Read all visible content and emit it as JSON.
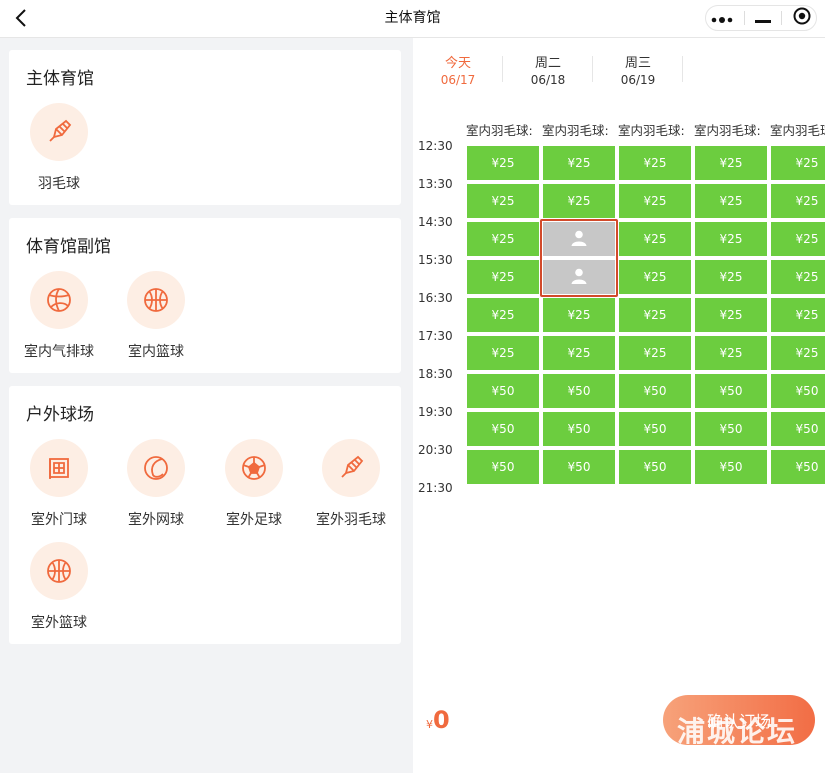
{
  "topbar": {
    "title": "主体育馆",
    "back_icon": "chevron-left-icon",
    "menu_icons": [
      "more-dots-icon",
      "minimize-icon",
      "target-close-icon"
    ]
  },
  "colors": {
    "accent": "#f06a3e",
    "available": "#6ccd3f",
    "booked": "#c7c7c7",
    "selection": "#d24a2a",
    "icon_bg": "#fdeee4"
  },
  "venues": [
    {
      "title": "主体育馆",
      "sports": [
        {
          "label": "羽毛球",
          "icon": "badminton-icon"
        }
      ]
    },
    {
      "title": "体育馆副馆",
      "sports": [
        {
          "label": "室内气排球",
          "icon": "volleyball-icon"
        },
        {
          "label": "室内篮球",
          "icon": "basketball-icon"
        }
      ]
    },
    {
      "title": "户外球场",
      "sports": [
        {
          "label": "室外门球",
          "icon": "gateball-icon"
        },
        {
          "label": "室外网球",
          "icon": "tennis-icon"
        },
        {
          "label": "室外足球",
          "icon": "football-icon"
        },
        {
          "label": "室外羽毛球",
          "icon": "badminton-icon"
        },
        {
          "label": "室外篮球",
          "icon": "basketball-icon"
        }
      ]
    }
  ],
  "days": [
    {
      "week": "今天",
      "date": "06/17",
      "active": true
    },
    {
      "week": "周二",
      "date": "06/18",
      "active": false
    },
    {
      "week": "周三",
      "date": "06/19",
      "active": false
    }
  ],
  "court_headers": [
    "室内羽毛球:",
    "室内羽毛球:",
    "室内羽毛球:",
    "室内羽毛球:",
    "室内羽毛球"
  ],
  "times": [
    "12:30",
    "13:30",
    "14:30",
    "15:30",
    "16:30",
    "17:30",
    "18:30",
    "19:30",
    "20:30",
    "21:30"
  ],
  "rows": [
    [
      "¥25",
      "¥25",
      "¥25",
      "¥25",
      "¥25"
    ],
    [
      "¥25",
      "¥25",
      "¥25",
      "¥25",
      "¥25"
    ],
    [
      "¥25",
      "booked",
      "¥25",
      "¥25",
      "¥25"
    ],
    [
      "¥25",
      "booked",
      "¥25",
      "¥25",
      "¥25"
    ],
    [
      "¥25",
      "¥25",
      "¥25",
      "¥25",
      "¥25"
    ],
    [
      "¥25",
      "¥25",
      "¥25",
      "¥25",
      "¥25"
    ],
    [
      "¥50",
      "¥50",
      "¥50",
      "¥50",
      "¥50"
    ],
    [
      "¥50",
      "¥50",
      "¥50",
      "¥50",
      "¥50"
    ],
    [
      "¥50",
      "¥50",
      "¥50",
      "¥50",
      "¥50"
    ]
  ],
  "footer": {
    "currency": "¥",
    "total": "0",
    "confirm_label": "确认订场",
    "watermark": "浦城论坛"
  }
}
